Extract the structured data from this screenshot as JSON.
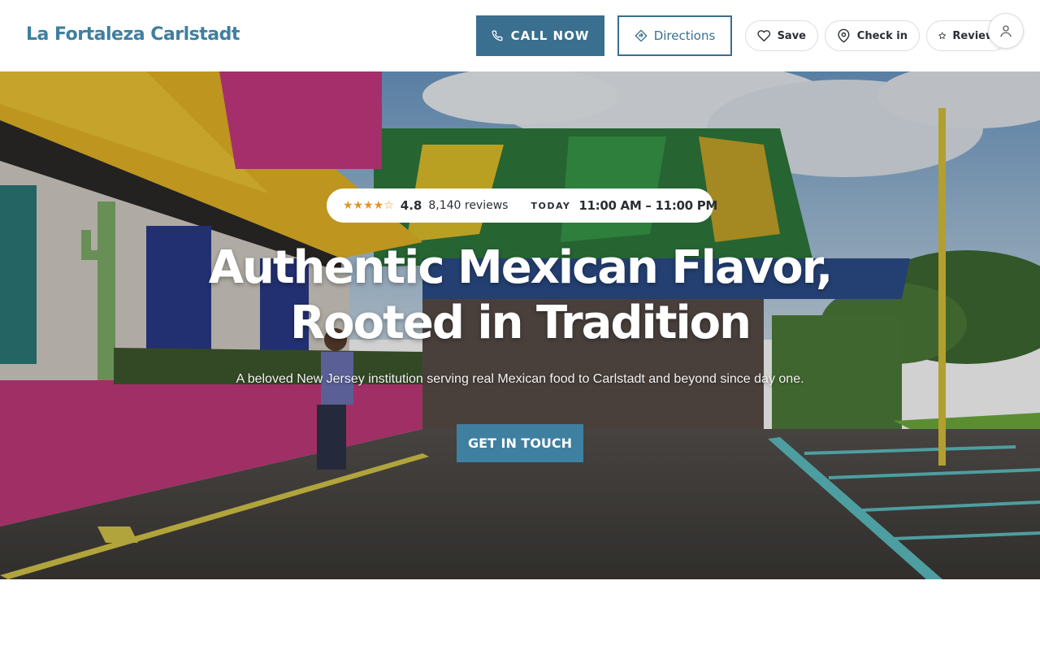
{
  "header": {
    "brand": "La Fortaleza Carlstadt",
    "call_label": "CALL NOW",
    "directions_label": "Directions",
    "save_label": "Save",
    "checkin_label": "Check in",
    "review_label": "Review"
  },
  "hero": {
    "stars": "★★★★☆",
    "rating": "4.8",
    "reviews": "8,140 reviews",
    "today_label": "TODAY",
    "hours": "11:00 AM – 11:00 PM",
    "headline_line1": "Authentic Mexican Flavor,",
    "headline_line2": "Rooted in Tradition",
    "subtitle": "A beloved New Jersey institution serving real Mexican food to Carlstadt and beyond since day one.",
    "cta_label": "GET IN TOUCH"
  },
  "colors": {
    "brand": "#3f7fa0",
    "primary_button": "#3a6f8f",
    "star": "#e0952b"
  },
  "icons": [
    "phone-icon",
    "directions-icon",
    "heart-icon",
    "location-pin-icon",
    "star-icon",
    "user-icon"
  ]
}
